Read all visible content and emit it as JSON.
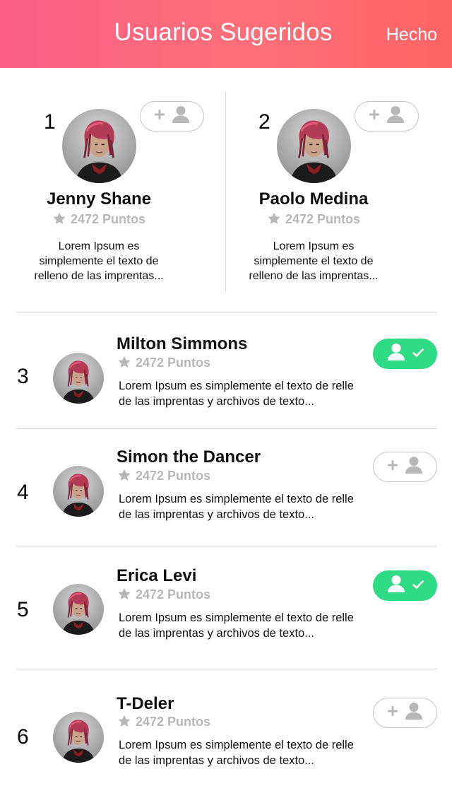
{
  "header": {
    "title": "Usuarios Sugeridos",
    "done_label": "Hecho",
    "gradient_start": "#fb5f87",
    "gradient_end": "#ff6464"
  },
  "colors": {
    "followed": "#2fdc85",
    "muted": "#b7b7b7",
    "divider": "#d3d3d3"
  },
  "featured": [
    {
      "rank": "1",
      "name": "Jenny Shane",
      "points": "2472 Puntos",
      "desc_lines": [
        "Lorem Ipsum es",
        "simplemente el texto de",
        "relleno de las imprentas..."
      ],
      "followed": false
    },
    {
      "rank": "2",
      "name": "Paolo Medina",
      "points": "2472 Puntos",
      "desc_lines": [
        "Lorem Ipsum es",
        "simplemente el texto de",
        "relleno de las imprentas..."
      ],
      "followed": false
    }
  ],
  "users": [
    {
      "rank": "3",
      "name": "Milton Simmons",
      "points": "2472 Puntos",
      "desc_lines": [
        "Lorem Ipsum es simplemente el texto de relle",
        "de las imprentas y archivos de texto..."
      ],
      "followed": true
    },
    {
      "rank": "4",
      "name": "Simon the Dancer",
      "points": "2472 Puntos",
      "desc_lines": [
        "Lorem Ipsum es simplemente el texto de relle",
        "de las imprentas y archivos de texto..."
      ],
      "followed": false
    },
    {
      "rank": "5",
      "name": "Erica Levi",
      "points": "2472 Puntos",
      "desc_lines": [
        "Lorem Ipsum es simplemente el texto de relle",
        "de las imprentas y archivos de texto..."
      ],
      "followed": true
    },
    {
      "rank": "6",
      "name": "T-Deler",
      "points": "2472 Puntos",
      "desc_lines": [
        "Lorem Ipsum es simplemente el texto de relle",
        "de las imprentas y archivos de texto..."
      ],
      "followed": false
    }
  ],
  "icons": {
    "star": "star-icon",
    "add_user": "add-user-icon",
    "user_check": "user-check-icon",
    "avatar": "avatar"
  }
}
